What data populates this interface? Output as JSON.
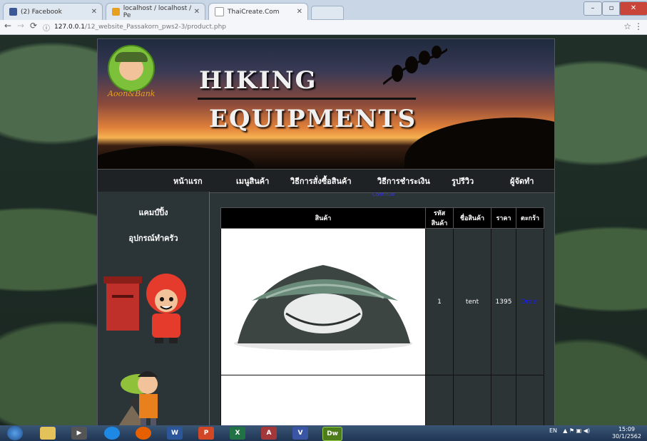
{
  "browser": {
    "tabs": [
      {
        "label": "(2) Facebook",
        "favicon_color": "#3b5998"
      },
      {
        "label": "localhost / localhost / Pe",
        "favicon_color": "#e8a020"
      },
      {
        "label": "ThaiCreate.Com",
        "favicon_color": "#ffffff"
      }
    ],
    "url_host": "127.0.0.1",
    "url_path": "/12_website_Passakorn_pws2-3/product.php"
  },
  "site": {
    "logo_text": "Aoon&Bank",
    "banner_title_1": "HIKING",
    "banner_title_2": "EQUIPMENTS",
    "nav": [
      "หน้าแรก",
      "เมนูสินค้า",
      "วิธีการสั่งซื้อสินค้า",
      "วิธีการชำระเงิน",
      "รูปรีวิว",
      "ผู้จัดทำ"
    ],
    "top_link": "Continue",
    "sidebar": [
      "แคมป์ปิ้ง",
      "อุปกรณ์ทำครัว"
    ]
  },
  "table": {
    "headers": [
      "สินค้า",
      "รหัสสินค้า",
      "ชื่อสินค้า",
      "ราคา",
      "ตะกร้า"
    ],
    "rows": [
      {
        "id": "1",
        "name": "tent",
        "price": "1395",
        "cart": "Order"
      },
      {
        "id": "",
        "name": "",
        "price": "",
        "cart": ""
      }
    ]
  },
  "taskbar": {
    "lang": "EN",
    "time": "15:09",
    "date": "30/1/2562"
  }
}
